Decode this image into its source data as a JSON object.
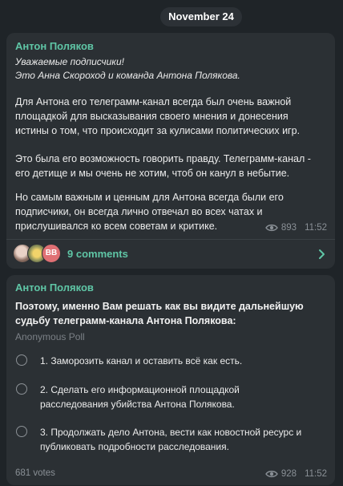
{
  "date_label": "November 24",
  "post1": {
    "author": "Антон Поляков",
    "greeting_lines": [
      "Уважаемые подписчики!",
      "Это Анна Скороход и команда Антона Полякова."
    ],
    "paragraph1_lines": [
      "Для Антона его телеграмм-канал всегда был очень важной",
      "площадкой для высказывания своего мнения и донесения",
      "истины о том, что происходит за кулисами политических игр."
    ],
    "paragraph2_lines": [
      "Это была его возможность говорить правду. Телеграмм-канал -",
      "его детище и мы очень не хотим, чтоб он канул в небытие."
    ],
    "paragraph3_lines": [
      "Но самым важным и ценным для Антона всегда были его",
      "подписчики, он всегда лично отвечал во всех чатах и",
      "прислушивался ко всем советам и критике."
    ],
    "views": "893",
    "time": "11:52",
    "avatar3_initials": "BB",
    "comments_label": "9 comments"
  },
  "post2": {
    "author": "Антон Поляков",
    "question_lines": [
      "Поэтому, именно Вам решать как вы видите дальнейшую",
      "судьбу телеграмм-канала Антона Полякова:"
    ],
    "poll_type": "Anonymous Poll",
    "options": [
      {
        "lines": [
          "1. Заморозить канал и оставить всё как есть."
        ]
      },
      {
        "lines": [
          "2. Сделать его информационной  площадкой",
          "расследования убийства Антона Полякова."
        ]
      },
      {
        "lines": [
          "3. Продолжать дело Антона, вести как новостной ресурс и",
          "публиковать подробности расследования."
        ]
      }
    ],
    "votes": "681 votes",
    "views": "928",
    "time": "11:52"
  },
  "icons": {
    "views": "eye-icon",
    "chevron": "chevron-right-icon",
    "radio": "radio-button-icon"
  },
  "colors": {
    "background": "#1f2428",
    "bubble": "#2b3034",
    "accent": "#5fc6a6",
    "secondary_text": "#8a9096"
  }
}
